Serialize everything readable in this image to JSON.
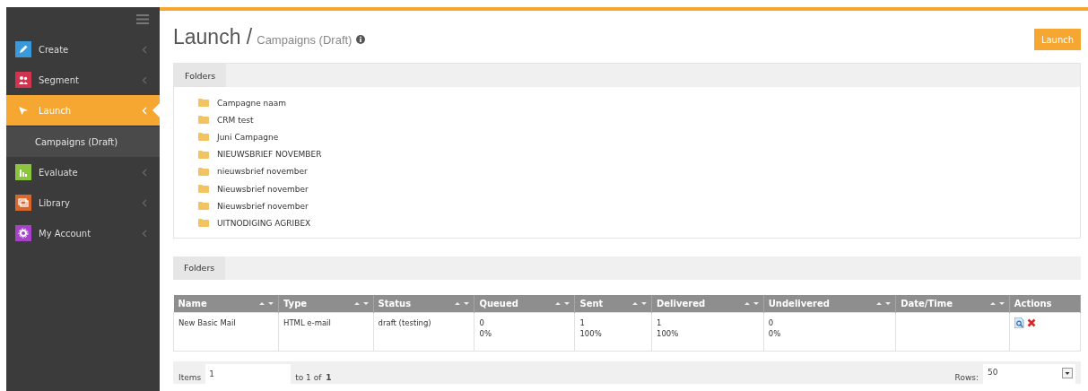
{
  "sidebar": {
    "items": [
      {
        "label": "Create",
        "color": "#3a9ad9",
        "selected": false
      },
      {
        "label": "Segment",
        "color": "#d0344f",
        "selected": false
      },
      {
        "label": "Launch",
        "selected": true,
        "children": [
          {
            "label": "Campaigns (Draft)",
            "selected": true
          }
        ]
      },
      {
        "label": "Evaluate",
        "color": "#8cc63f",
        "selected": false
      },
      {
        "label": "Library",
        "color": "#d9662b",
        "selected": false
      },
      {
        "label": "My Account",
        "color": "#a642c8",
        "selected": false
      }
    ]
  },
  "header": {
    "title": "Launch /",
    "subtitle": "Campaigns (Draft)",
    "button": "Launch"
  },
  "folders_panel": {
    "tab": "Folders",
    "folders": [
      "Campagne naam",
      "CRM test",
      "Juni Campagne",
      "NIEUWSBRIEF NOVEMBER",
      "nieuwsbrief november",
      "Nieuwsbrief november",
      "Nieuwsbrief november",
      "UITNODIGING AGRIBEX"
    ]
  },
  "second_panel": {
    "tab": "Folders"
  },
  "table": {
    "columns": [
      "Name",
      "Type",
      "Status",
      "Queued",
      "Sent",
      "Delivered",
      "Undelivered",
      "Date/Time",
      "Actions"
    ],
    "rows": [
      {
        "cells": [
          {
            "kind": "text",
            "lines": [
              "New Basic Mail"
            ]
          },
          {
            "kind": "text",
            "lines": [
              "HTML e-mail"
            ]
          },
          {
            "kind": "text",
            "lines": [
              "draft (testing)"
            ]
          },
          {
            "kind": "text",
            "lines": [
              "0",
              "0%"
            ]
          },
          {
            "kind": "text",
            "lines": [
              "1",
              "100%"
            ]
          },
          {
            "kind": "text",
            "lines": [
              "1",
              "100%"
            ]
          },
          {
            "kind": "text",
            "lines": [
              "0",
              "0%"
            ]
          },
          {
            "kind": "empty"
          },
          {
            "kind": "actions"
          }
        ]
      }
    ]
  },
  "pager": {
    "items_label": "Items",
    "items_value": "1",
    "range": "to 1 of",
    "total": "1",
    "rows_label": "Rows:",
    "rows_value": "50"
  }
}
